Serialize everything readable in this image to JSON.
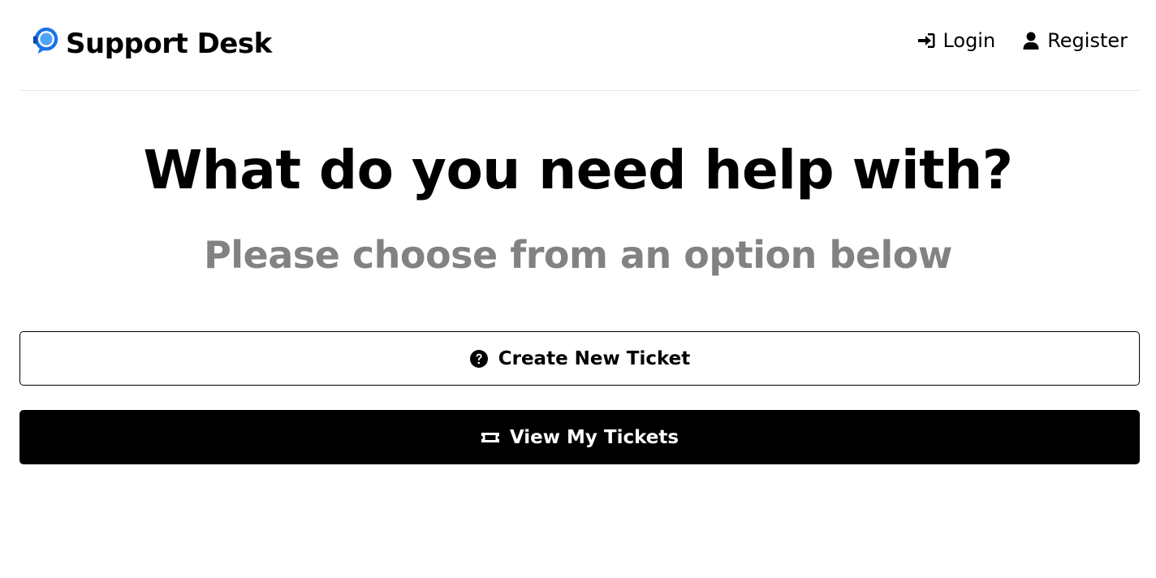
{
  "header": {
    "logo_text": "Support Desk",
    "logo_icon": "support-chat-icon",
    "nav": [
      {
        "label": "Login",
        "icon": "sign-in-icon"
      },
      {
        "label": "Register",
        "icon": "user-icon"
      }
    ]
  },
  "hero": {
    "title": "What do you need help with?",
    "subtitle": "Please choose from an option below"
  },
  "actions": {
    "create_label": "Create New Ticket",
    "create_icon": "question-circle-icon",
    "view_label": "View My Tickets",
    "view_icon": "ticket-icon"
  },
  "colors": {
    "accent": "#1a73e8",
    "subtitle": "#828282",
    "primary_button_bg": "#000000",
    "primary_button_text": "#ffffff"
  }
}
